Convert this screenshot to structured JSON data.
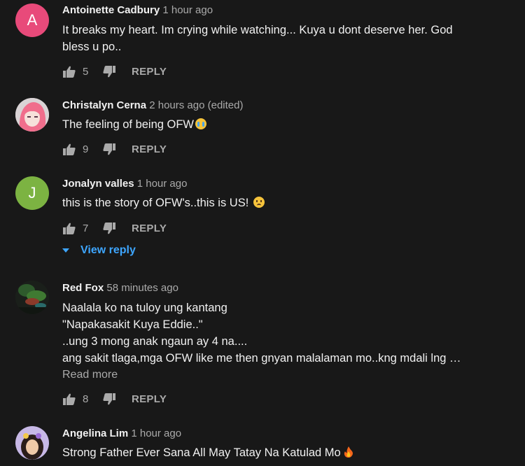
{
  "comments": [
    {
      "author": "Antoinette Cadbury",
      "time": "1 hour ago",
      "avatar_letter": "A",
      "avatar_color": "#e84a7a",
      "text": "It breaks my heart. Im crying while watching... Kuya u dont deserve her. God\nbless u po..",
      "likes": "5",
      "reply_label": "REPLY"
    },
    {
      "author": "Christalyn Cerna",
      "time": "2 hours ago (edited)",
      "text": "The feeling of being OFW",
      "emoji": "crying-face-emoji",
      "likes": "9",
      "reply_label": "REPLY"
    },
    {
      "author": "Jonalyn valles",
      "time": "1 hour ago",
      "avatar_letter": "J",
      "avatar_color": "#7cb342",
      "text": "this is the story of OFW's..this is US!",
      "emoji": "frowning-face-emoji",
      "likes": "7",
      "reply_label": "REPLY",
      "view_reply": "View reply"
    },
    {
      "author": "Red Fox",
      "time": "58 minutes ago",
      "text": "Naalala ko na tuloy ung kantang\n\"Napakasakit Kuya Eddie..\"\n..ung 3 mong anak ngaun ay 4 na....\nang sakit tlaga,mga OFW like me then gnyan malalaman mo..kng mdali lng …",
      "read_more": "Read more",
      "likes": "8",
      "reply_label": "REPLY"
    },
    {
      "author": "Angelina Lim",
      "time": "1 hour ago",
      "text": "Strong Father Ever Sana All May Tatay Na Katulad Mo",
      "emoji": "fire-emoji"
    }
  ]
}
